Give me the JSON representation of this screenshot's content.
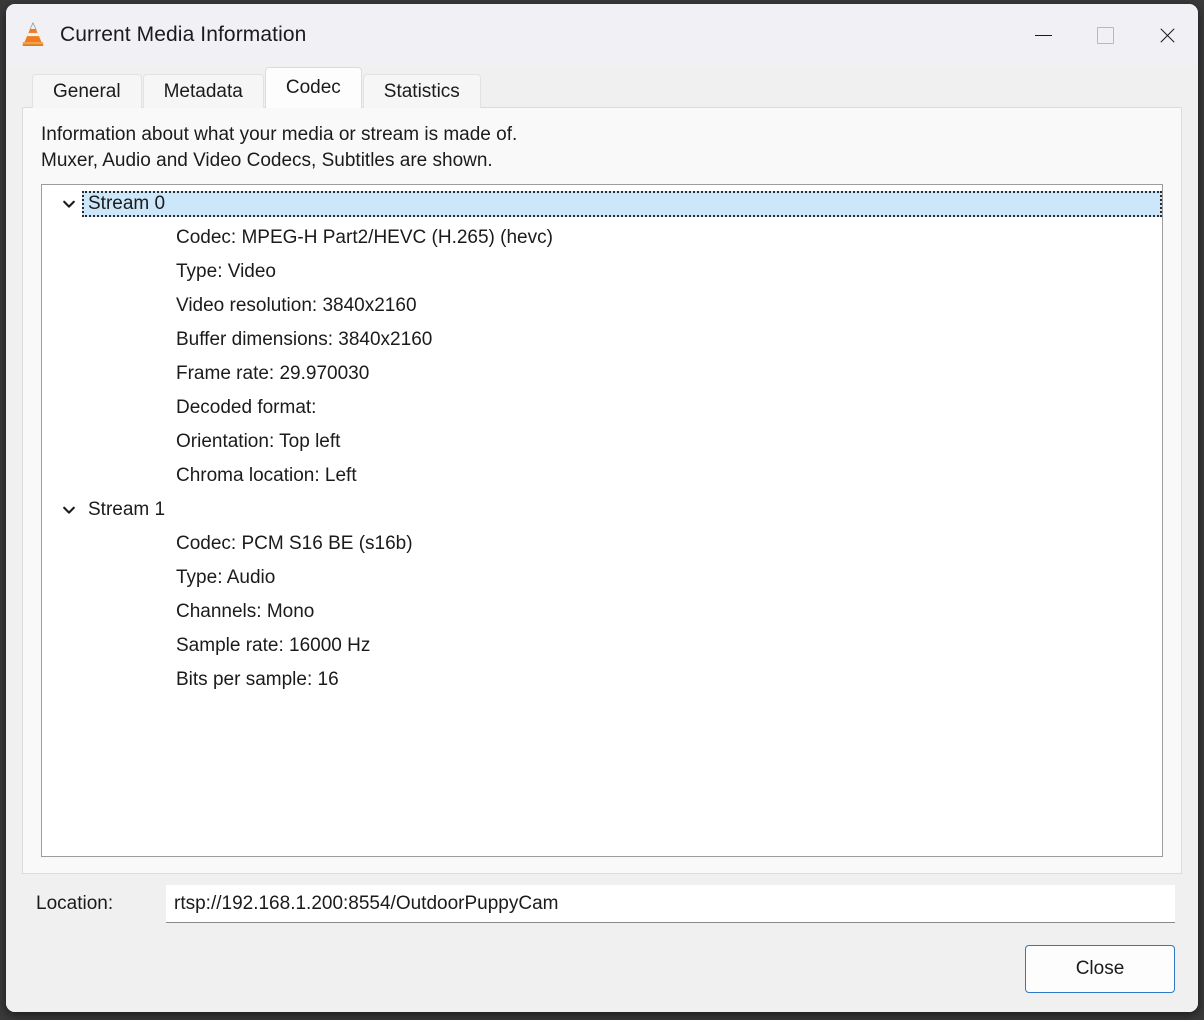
{
  "window": {
    "title": "Current Media Information",
    "app_icon": "vlc-cone-icon",
    "controls": {
      "minimize": "minimize-icon",
      "maximize": "maximize-icon",
      "close": "close-icon"
    }
  },
  "tabs": [
    {
      "label": "General",
      "active": false
    },
    {
      "label": "Metadata",
      "active": false
    },
    {
      "label": "Codec",
      "active": true
    },
    {
      "label": "Statistics",
      "active": false
    }
  ],
  "codec_panel": {
    "description_line_1": "Information about what your media or stream is made of.",
    "description_line_2": "Muxer, Audio and Video Codecs, Subtitles are shown.",
    "streams": [
      {
        "label": "Stream 0",
        "expanded": true,
        "selected": true,
        "details": [
          "Codec: MPEG-H Part2/HEVC (H.265) (hevc)",
          "Type: Video",
          "Video resolution: 3840x2160",
          "Buffer dimensions: 3840x2160",
          "Frame rate: 29.970030",
          "Decoded format:",
          "Orientation: Top left",
          "Chroma location: Left"
        ]
      },
      {
        "label": "Stream 1",
        "expanded": true,
        "selected": false,
        "details": [
          "Codec: PCM S16 BE (s16b)",
          "Type: Audio",
          "Channels: Mono",
          "Sample rate: 16000 Hz",
          "Bits per sample: 16"
        ]
      }
    ]
  },
  "location": {
    "label": "Location:",
    "value": "rtsp://192.168.1.200:8554/OutdoorPuppyCam",
    "placeholder": ""
  },
  "footer": {
    "close_label": "Close"
  },
  "colors": {
    "titlebar_bg": "#f1f0f5",
    "dialog_bg": "#f0f0f0",
    "panel_bg": "#f9f9f9",
    "tree_bg": "#ffffff",
    "selection_bg": "#cce6fa",
    "accent": "#2f78c4",
    "text": "#1b1b1b"
  }
}
